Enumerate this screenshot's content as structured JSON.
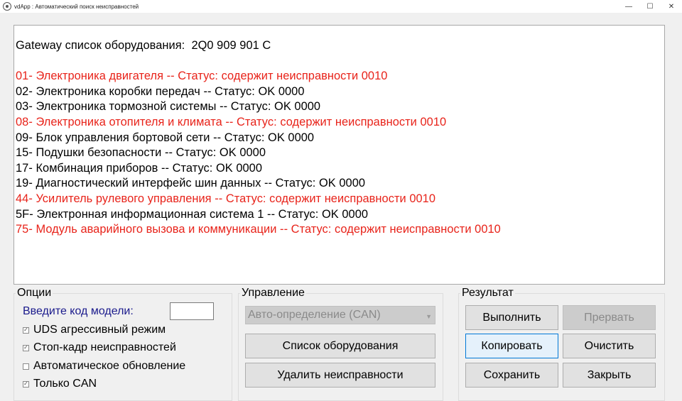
{
  "window": {
    "title": "vdApp :  Автоматический поиск неисправностей",
    "controls": {
      "minimize": "—",
      "maximize": "☐",
      "close": "✕"
    }
  },
  "output": {
    "lines": [
      {
        "text": "Gateway список оборудования:  2Q0 909 901 C",
        "fault": false
      },
      {
        "text": "",
        "fault": false
      },
      {
        "text": "01- Электроника двигателя -- Статус: содержит неисправности 0010",
        "fault": true
      },
      {
        "text": "02- Электроника коробки передач -- Статус: OK 0000",
        "fault": false
      },
      {
        "text": "03- Электроника тормозной системы -- Статус: OK 0000",
        "fault": false
      },
      {
        "text": "08- Электроника отопителя и климата -- Статус: содержит неисправности 0010",
        "fault": true
      },
      {
        "text": "09- Блок управления бортовой сети -- Статус: OK 0000",
        "fault": false
      },
      {
        "text": "15- Подушки безопасности -- Статус: OK 0000",
        "fault": false
      },
      {
        "text": "17- Комбинация приборов -- Статус: OK 0000",
        "fault": false
      },
      {
        "text": "19- Диагностический интерфейс шин данных -- Статус: OK 0000",
        "fault": false
      },
      {
        "text": "44- Усилитель рулевого управления -- Статус: содержит неисправности 0010",
        "fault": true
      },
      {
        "text": "5F- Электронная информационная система 1 -- Статус: OK 0000",
        "fault": false
      },
      {
        "text": "75- Модуль аварийного вызова и коммуникации -- Статус: содержит неисправности 0010",
        "fault": true
      }
    ]
  },
  "options": {
    "title": "Опции",
    "model_code_label": "Введите код модели:",
    "model_code_value": "",
    "checkboxes": [
      {
        "label": "UDS агрессивный режим",
        "checked": true
      },
      {
        "label": "Стоп-кадр неисправностей",
        "checked": true
      },
      {
        "label": "Автоматическое обновление",
        "checked": false
      },
      {
        "label": "Только CAN",
        "checked": true
      }
    ]
  },
  "control": {
    "title": "Управление",
    "mode_selected": "Авто-определение (CAN)",
    "equipment_list_label": "Список оборудования",
    "delete_faults_label": "Удалить неисправности"
  },
  "result": {
    "title": "Результат",
    "run_label": "Выполнить",
    "abort_label": "Прервать",
    "copy_label": "Копировать",
    "clear_label": "Очистить",
    "save_label": "Сохранить",
    "close_label": "Закрыть"
  },
  "colors": {
    "fault_text": "#e8231a",
    "ok_text": "#000000",
    "label_blue": "#1a1a8c"
  }
}
